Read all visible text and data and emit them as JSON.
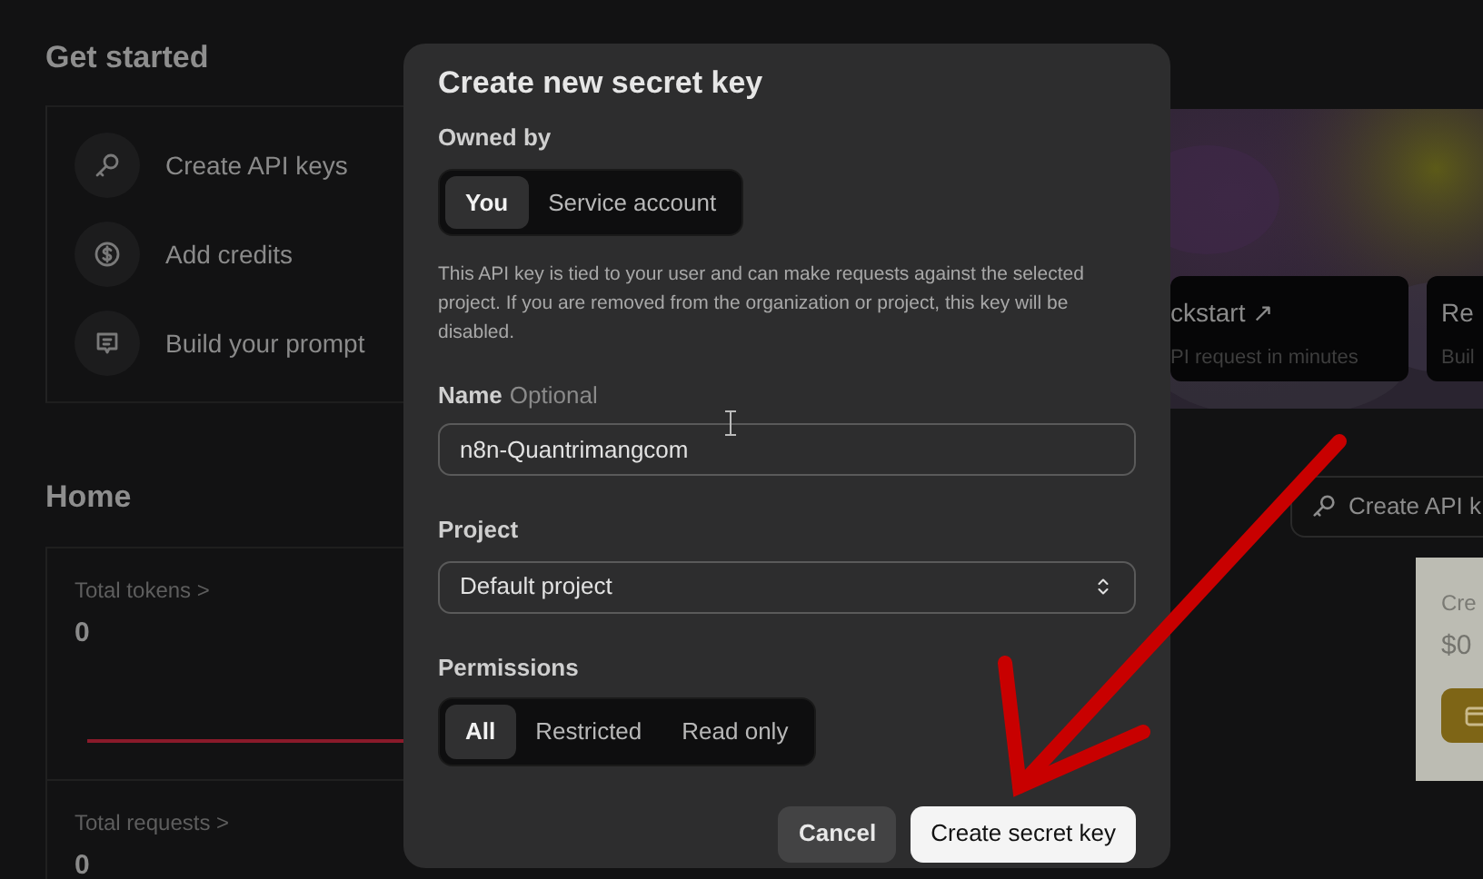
{
  "get_started": {
    "title": "Get started",
    "items": [
      {
        "label": "Create API keys"
      },
      {
        "label": "Add credits"
      },
      {
        "label": "Build your prompt"
      }
    ]
  },
  "banner": {
    "cards": [
      {
        "title": "ckstart ↗",
        "subtitle": "PI request in minutes"
      },
      {
        "title": "Re",
        "subtitle": "Buil"
      }
    ]
  },
  "home": {
    "title": "Home",
    "create_button": "Create API k",
    "metrics": [
      {
        "label": "Total tokens >",
        "value": "0"
      },
      {
        "label": "Total requests >",
        "value": "0"
      }
    ],
    "credits_card": {
      "title": "Cre",
      "amount": "$0"
    }
  },
  "modal": {
    "title": "Create new secret key",
    "owned_by": {
      "label": "Owned by",
      "options": [
        {
          "label": "You",
          "selected": true
        },
        {
          "label": "Service account",
          "selected": false
        }
      ]
    },
    "description": "This API key is tied to your user and can make requests against the selected project. If you are removed from the organization or project, this key will be disabled.",
    "name": {
      "label": "Name",
      "hint": "Optional",
      "value": "n8n-Quantrimangcom"
    },
    "project": {
      "label": "Project",
      "value": "Default project"
    },
    "permissions": {
      "label": "Permissions",
      "options": [
        {
          "label": "All",
          "selected": true
        },
        {
          "label": "Restricted",
          "selected": false
        },
        {
          "label": "Read only",
          "selected": false
        }
      ]
    },
    "buttons": [
      {
        "label": "Cancel",
        "kind": "secondary"
      },
      {
        "label": "Create secret key",
        "kind": "primary"
      }
    ]
  }
}
